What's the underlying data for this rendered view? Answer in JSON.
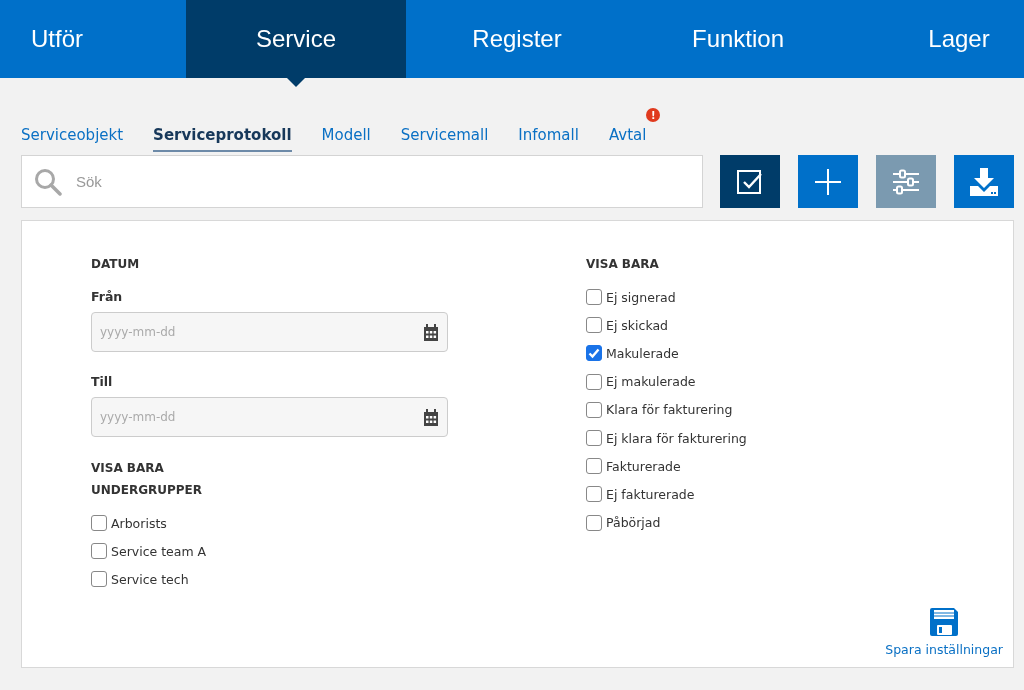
{
  "nav": [
    {
      "label": "Utför",
      "selected": false
    },
    {
      "label": "Service",
      "selected": true
    },
    {
      "label": "Register",
      "selected": false
    },
    {
      "label": "Funktion",
      "selected": false
    },
    {
      "label": "Lager",
      "selected": false
    }
  ],
  "subtabs": [
    {
      "label": "Serviceobjekt",
      "selected": false
    },
    {
      "label": "Serviceprotokoll",
      "selected": true
    },
    {
      "label": "Modell",
      "selected": false
    },
    {
      "label": "Servicemall",
      "selected": false
    },
    {
      "label": "Infomall",
      "selected": false
    },
    {
      "label": "Avtal",
      "selected": false,
      "badge": "!"
    }
  ],
  "search": {
    "placeholder": "Sök"
  },
  "toolbar": [
    {
      "kind": "select",
      "selected": true,
      "disabled": false
    },
    {
      "kind": "add",
      "selected": false,
      "disabled": false
    },
    {
      "kind": "filter",
      "selected": false,
      "disabled": true
    },
    {
      "kind": "download",
      "selected": false,
      "disabled": false
    }
  ],
  "filters": {
    "date": {
      "heading": "DATUM",
      "fields": [
        {
          "label": "Från",
          "placeholder": "yyyy-mm-dd"
        },
        {
          "label": "Till",
          "placeholder": "yyyy-mm-dd"
        }
      ]
    },
    "subgroups": {
      "heading_1": "VISA BARA",
      "heading_2": "UNDERGRUPPER",
      "items": [
        {
          "label": "Arborists",
          "checked": false
        },
        {
          "label": "Service team A",
          "checked": false
        },
        {
          "label": "Service tech",
          "checked": false
        }
      ]
    },
    "show_only": {
      "heading": "VISA BARA",
      "items": [
        {
          "label": "Ej signerad",
          "checked": false
        },
        {
          "label": "Ej skickad",
          "checked": false
        },
        {
          "label": "Makulerade",
          "checked": true
        },
        {
          "label": "Ej makulerade",
          "checked": false
        },
        {
          "label": "Klara för fakturering",
          "checked": false
        },
        {
          "label": "Ej klara för fakturering",
          "checked": false
        },
        {
          "label": "Fakturerade",
          "checked": false
        },
        {
          "label": "Ej fakturerade",
          "checked": false
        },
        {
          "label": "Påbörjad",
          "checked": false
        }
      ]
    }
  },
  "save": {
    "label": "Spara inställningar"
  }
}
